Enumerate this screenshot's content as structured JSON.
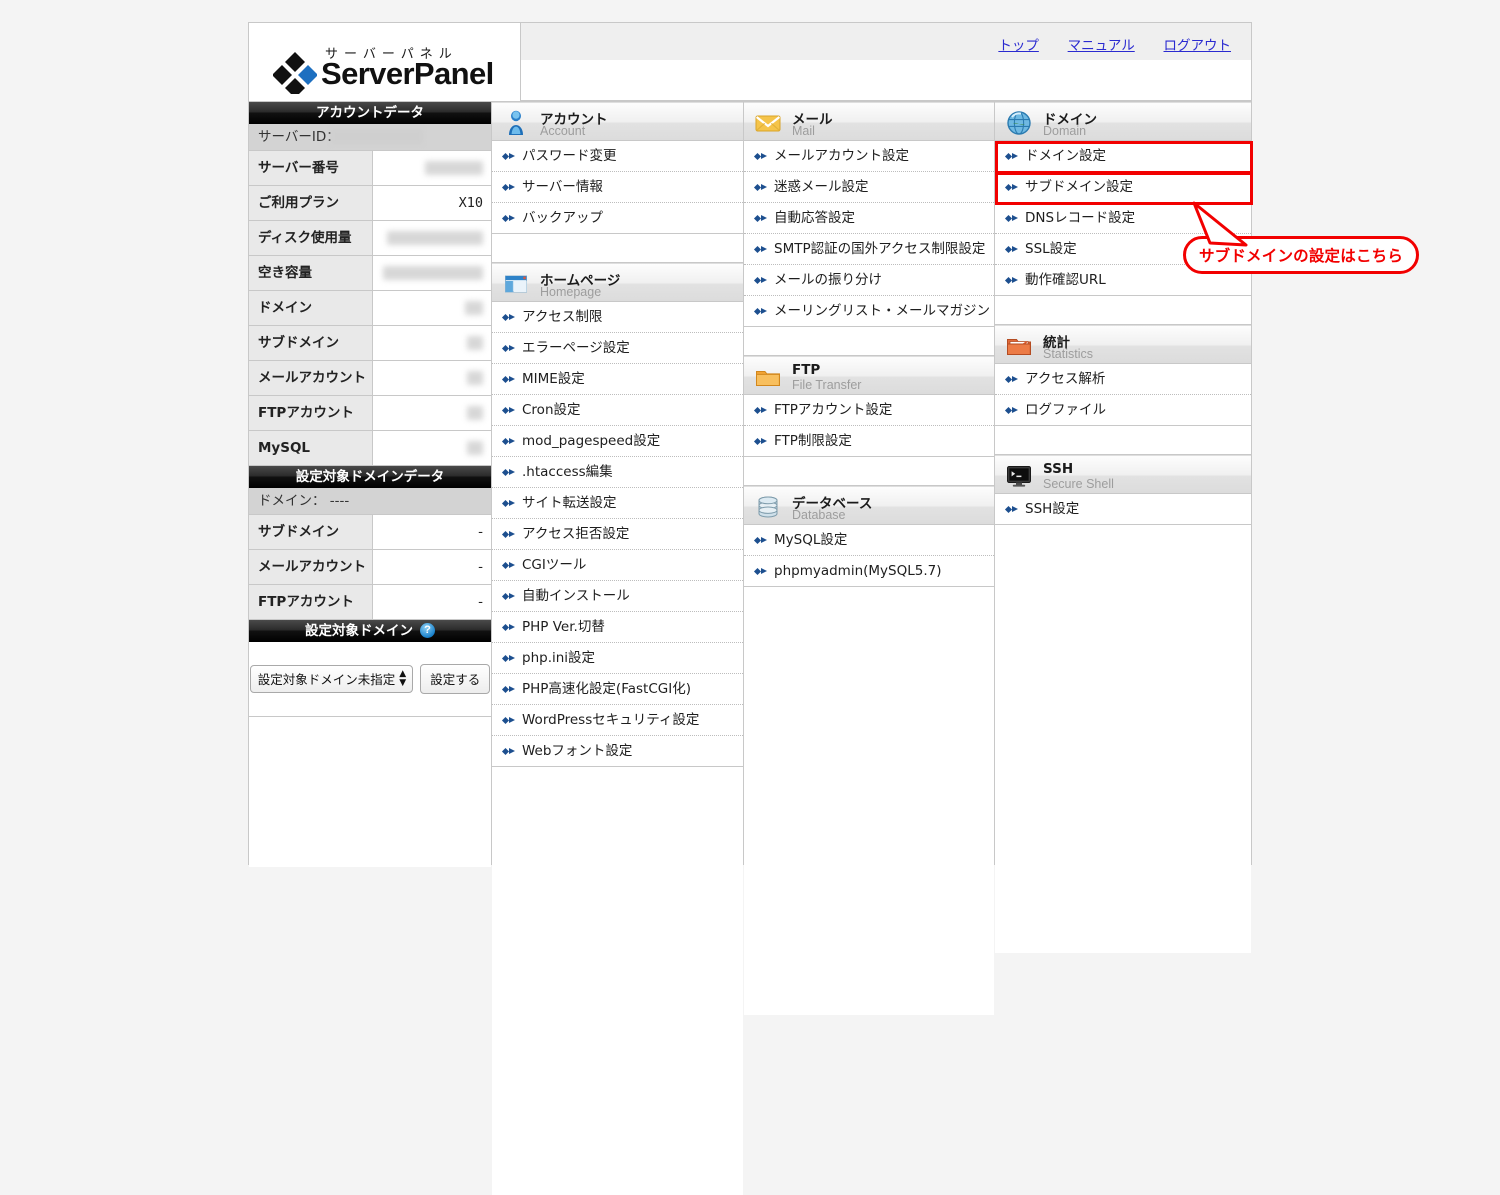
{
  "brand": {
    "kana": "サーバーパネル",
    "name": "ServerPanel"
  },
  "topnav": [
    {
      "label": "トップ"
    },
    {
      "label": "マニュアル"
    },
    {
      "label": "ログアウト"
    }
  ],
  "sidebar": {
    "account_data_title": "アカウントデータ",
    "server_id_label": "サーバーID：",
    "server_id_value": "",
    "rows": [
      {
        "key": "サーバー番号",
        "value": "",
        "masked": true,
        "mask_w": 58
      },
      {
        "key": "ご利用プラン",
        "value": "X10",
        "masked": false,
        "mask_w": 0
      },
      {
        "key": "ディスク使用量",
        "value": "",
        "masked": true,
        "mask_w": 96
      },
      {
        "key": "空き容量",
        "value": "",
        "masked": true,
        "mask_w": 100
      },
      {
        "key": "ドメイン",
        "value": "",
        "masked": true,
        "mask_w": 18
      },
      {
        "key": "サブドメイン",
        "value": "",
        "masked": true,
        "mask_w": 16
      },
      {
        "key": "メールアカウント",
        "value": "",
        "masked": true,
        "mask_w": 16
      },
      {
        "key": "FTPアカウント",
        "value": "",
        "masked": true,
        "mask_w": 16
      },
      {
        "key": "MySQL",
        "value": "",
        "masked": true,
        "mask_w": 16
      }
    ],
    "target_domain_data_title": "設定対象ドメインデータ",
    "target_domain_label": "ドメイン：  ----",
    "target_rows": [
      {
        "key": "サブドメイン",
        "value": "-"
      },
      {
        "key": "メールアカウント",
        "value": "-"
      },
      {
        "key": "FTPアカウント",
        "value": "-"
      }
    ],
    "target_domain_title": "設定対象ドメイン",
    "help_icon": "question-mark-icon",
    "domain_select_value": "設定対象ドメイン未指定",
    "domain_apply_button": "設定する"
  },
  "columns": [
    {
      "sections": [
        {
          "icon": "person-icon",
          "title_ja": "アカウント",
          "title_en": "Account",
          "items": [
            {
              "label": "パスワード変更"
            },
            {
              "label": "サーバー情報"
            },
            {
              "label": "バックアップ"
            }
          ]
        },
        {
          "icon": "homepage-icon",
          "title_ja": "ホームページ",
          "title_en": "Homepage",
          "items": [
            {
              "label": "アクセス制限"
            },
            {
              "label": "エラーページ設定"
            },
            {
              "label": "MIME設定"
            },
            {
              "label": "Cron設定"
            },
            {
              "label": "mod_pagespeed設定"
            },
            {
              "label": ".htaccess編集"
            },
            {
              "label": "サイト転送設定"
            },
            {
              "label": "アクセス拒否設定"
            },
            {
              "label": "CGIツール"
            },
            {
              "label": "自動インストール"
            },
            {
              "label": "PHP Ver.切替"
            },
            {
              "label": "php.ini設定"
            },
            {
              "label": "PHP高速化設定(FastCGI化)"
            },
            {
              "label": "WordPressセキュリティ設定"
            },
            {
              "label": "Webフォント設定"
            }
          ]
        }
      ]
    },
    {
      "sections": [
        {
          "icon": "envelope-icon",
          "title_ja": "メール",
          "title_en": "Mail",
          "items": [
            {
              "label": "メールアカウント設定"
            },
            {
              "label": "迷惑メール設定"
            },
            {
              "label": "自動応答設定"
            },
            {
              "label": "SMTP認証の国外アクセス制限設定"
            },
            {
              "label": "メールの振り分け"
            },
            {
              "label": "メーリングリスト・メールマガジン"
            }
          ]
        },
        {
          "icon": "folder-icon",
          "title_ja": "FTP",
          "title_en": "File Transfer",
          "items": [
            {
              "label": "FTPアカウント設定"
            },
            {
              "label": "FTP制限設定"
            }
          ]
        },
        {
          "icon": "database-icon",
          "title_ja": "データベース",
          "title_en": "Database",
          "items": [
            {
              "label": "MySQL設定"
            },
            {
              "label": "phpmyadmin(MySQL5.7)"
            }
          ]
        }
      ]
    },
    {
      "sections": [
        {
          "icon": "globe-icon",
          "title_ja": "ドメイン",
          "title_en": "Domain",
          "items": [
            {
              "label": "ドメイン設定",
              "highlighted": true
            },
            {
              "label": "サブドメイン設定",
              "highlighted": true
            },
            {
              "label": "DNSレコード設定"
            },
            {
              "label": "SSL設定"
            },
            {
              "label": "動作確認URL"
            }
          ]
        },
        {
          "icon": "chart-folder-icon",
          "title_ja": "統計",
          "title_en": "Statistics",
          "items": [
            {
              "label": "アクセス解析"
            },
            {
              "label": "ログファイル"
            }
          ]
        },
        {
          "icon": "terminal-icon",
          "title_ja": "SSH",
          "title_en": "Secure Shell",
          "items": [
            {
              "label": "SSH設定"
            }
          ]
        }
      ]
    }
  ],
  "annotation": {
    "callout_text": "サブドメインの設定はこちら",
    "highlight_color": "#f20000"
  }
}
